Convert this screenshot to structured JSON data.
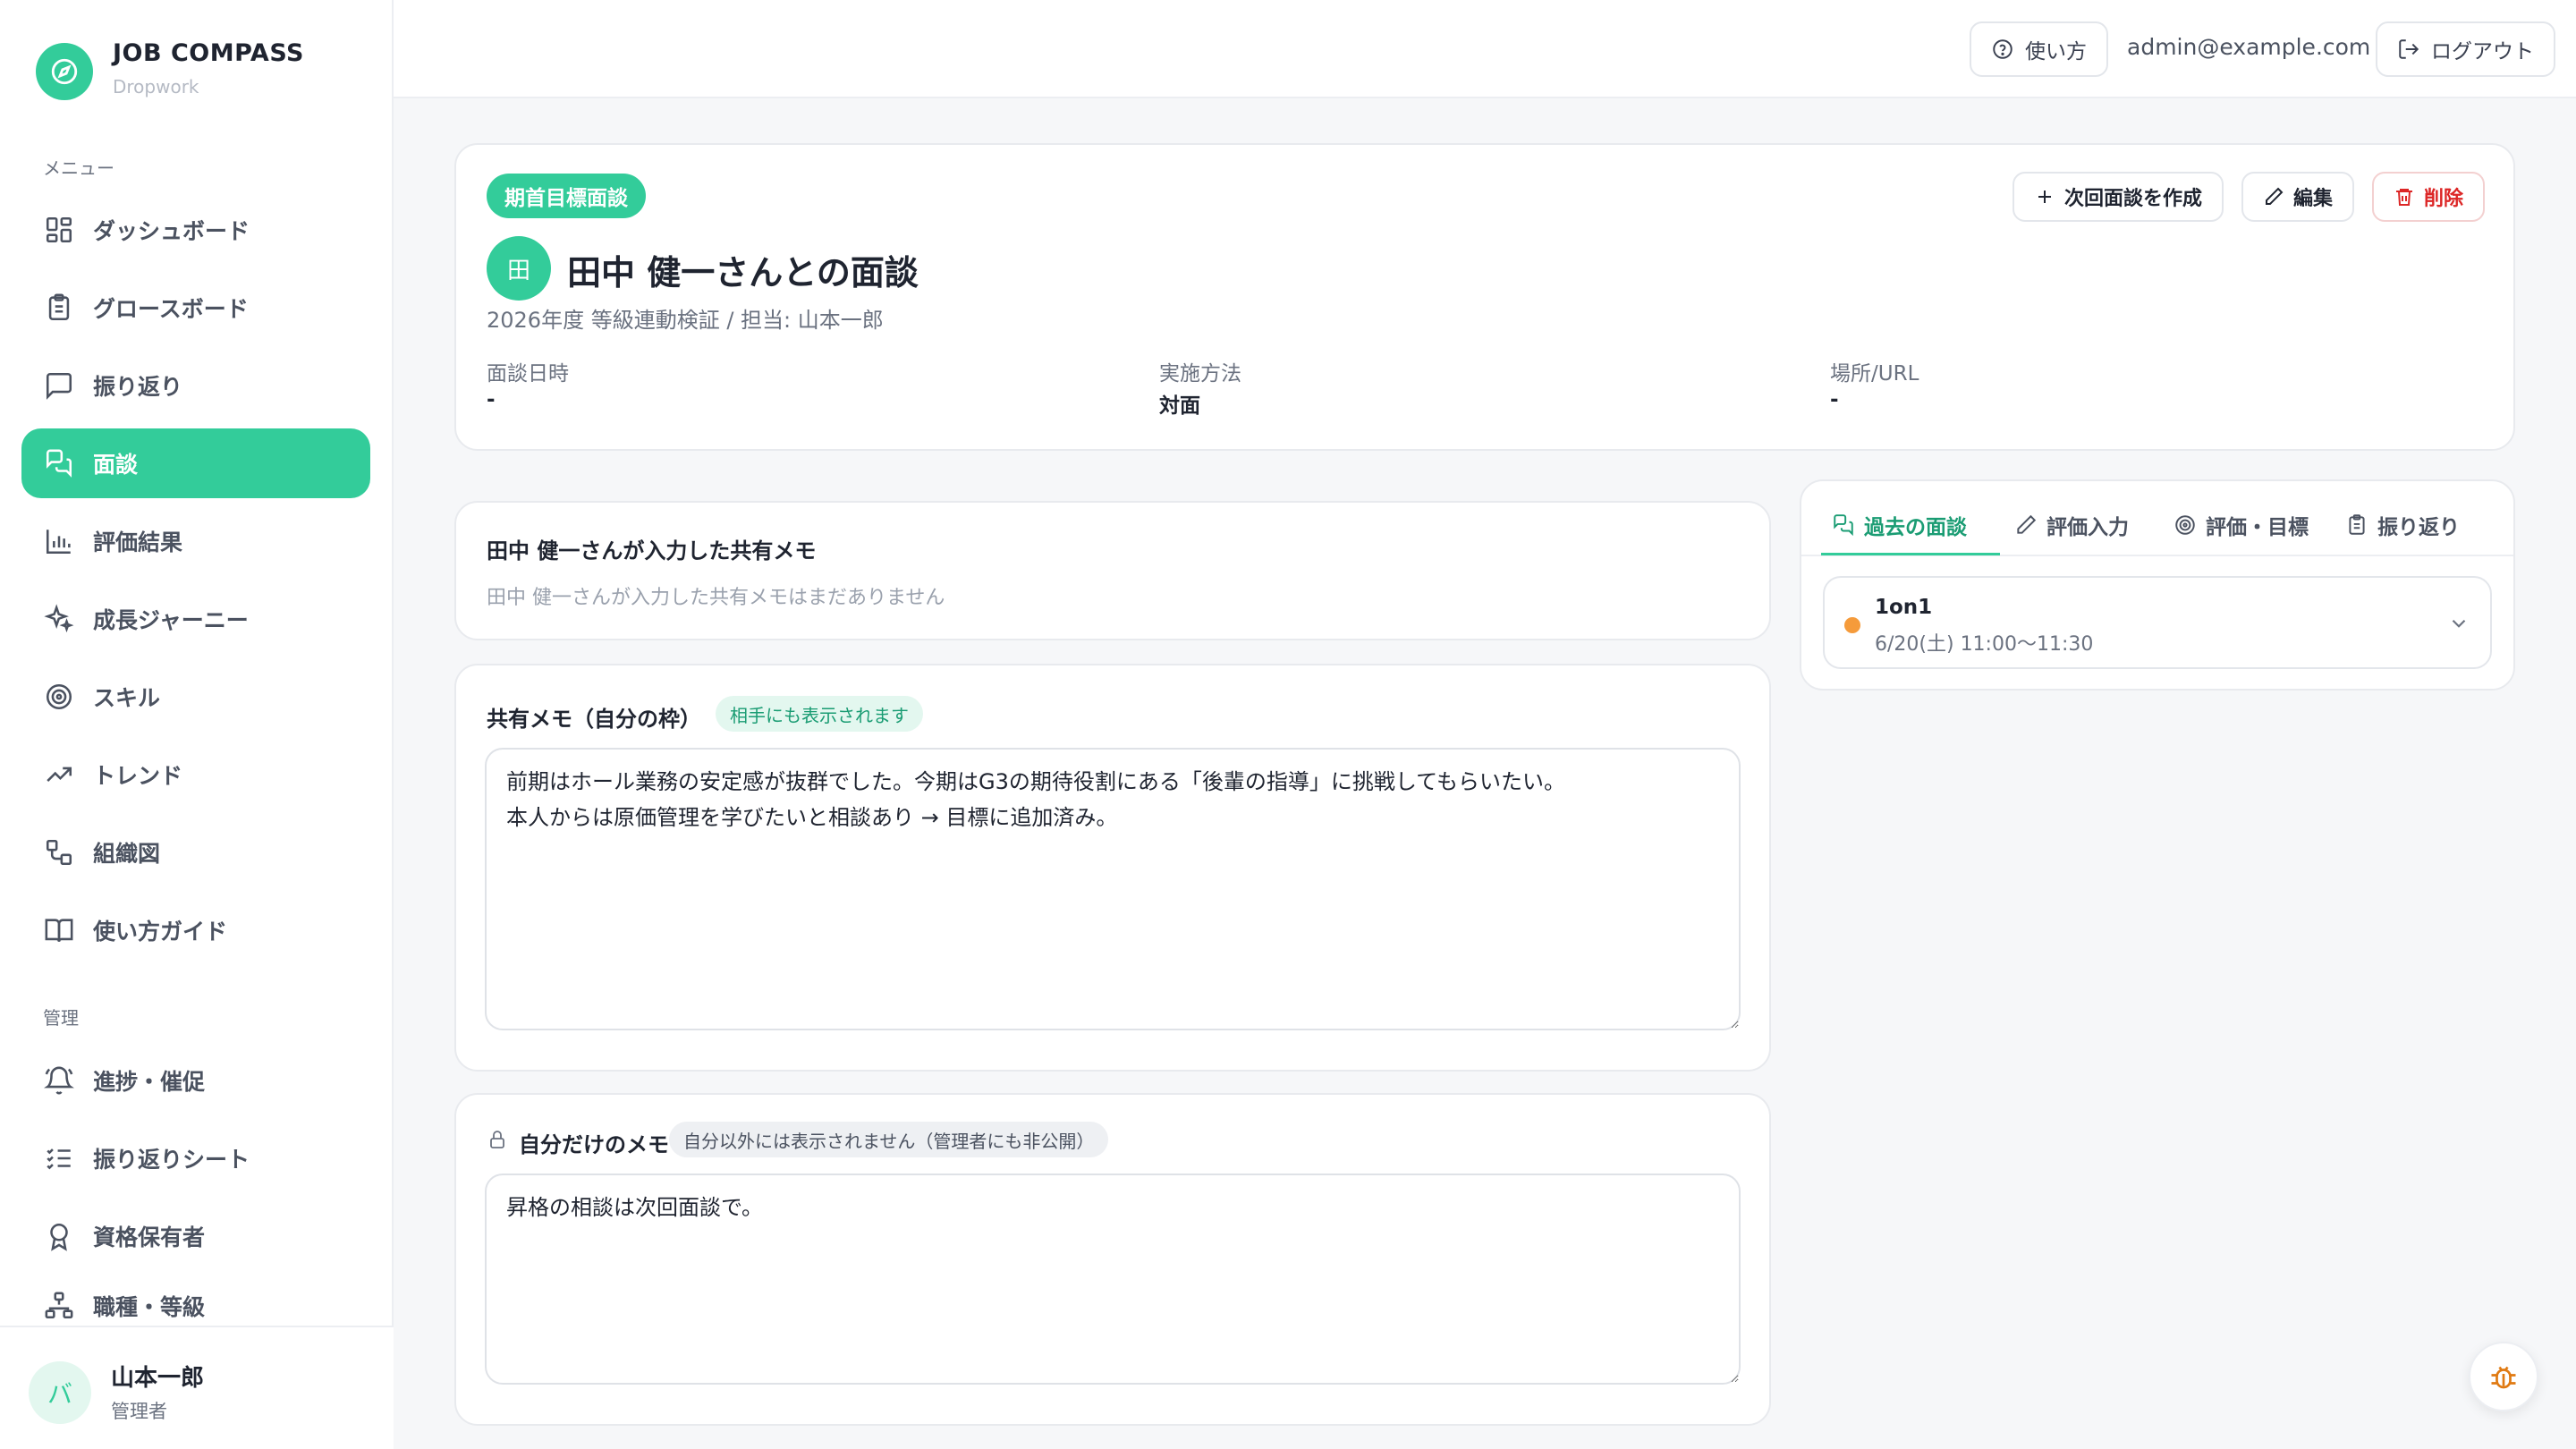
{
  "app": {
    "title": "JOB COMPASS",
    "subtitle": "Dropwork"
  },
  "sidebar": {
    "menu_label": "メニュー",
    "admin_label": "管理",
    "items": [
      {
        "label": "ダッシュボード",
        "icon": "grid-icon"
      },
      {
        "label": "グロースボード",
        "icon": "clipboard-icon"
      },
      {
        "label": "振り返り",
        "icon": "message-square-icon"
      },
      {
        "label": "面談",
        "icon": "chat-bubbles-icon",
        "active": true
      },
      {
        "label": "評価結果",
        "icon": "bar-chart-icon"
      },
      {
        "label": "成長ジャーニー",
        "icon": "sparkles-icon"
      },
      {
        "label": "スキル",
        "icon": "target-icon"
      },
      {
        "label": "トレンド",
        "icon": "trend-icon"
      },
      {
        "label": "組織図",
        "icon": "org-icon"
      },
      {
        "label": "使い方ガイド",
        "icon": "book-icon"
      }
    ],
    "admin_items": [
      {
        "label": "進捗・催促",
        "icon": "bell-icon"
      },
      {
        "label": "振り返りシート",
        "icon": "checklist-icon"
      },
      {
        "label": "資格保有者",
        "icon": "award-icon"
      },
      {
        "label": "職種・等級",
        "icon": "hierarchy-icon"
      }
    ],
    "user": {
      "initial": "バ",
      "name": "山本一郎",
      "role": "管理者"
    }
  },
  "header": {
    "help_label": "使い方",
    "email": "admin@example.com",
    "logout_label": "ログアウト"
  },
  "detail": {
    "type_badge": "期首目標面談",
    "avatar_initial": "田",
    "title": "田中 健一さんとの面談",
    "subtitle": "2026年度 等級連動検証 / 担当: 山本一郎",
    "actions": {
      "next": "次回面談を作成",
      "edit": "編集",
      "delete": "削除"
    },
    "meta": [
      {
        "label": "面談日時",
        "value": "-"
      },
      {
        "label": "実施方法",
        "value": "対面"
      },
      {
        "label": "場所/URL",
        "value": "-"
      }
    ]
  },
  "partner_memo": {
    "title": "田中 健一さんが入力した共有メモ",
    "empty": "田中 健一さんが入力した共有メモはまだありません"
  },
  "shared_memo": {
    "title": "共有メモ（自分の枠）",
    "badge": "相手にも表示されます",
    "value": "前期はホール業務の安定感が抜群でした。今期はG3の期待役割にある「後輩の指導」に挑戦してもらいたい。\n本人からは原価管理を学びたいと相談あり → 目標に追加済み。"
  },
  "private_memo": {
    "title": "自分だけのメモ",
    "badge": "自分以外には表示されません（管理者にも非公開）",
    "value": "昇格の相談は次回面談で。"
  },
  "side_panel": {
    "tabs": [
      {
        "label": "過去の面談",
        "icon": "chat-bubbles-icon",
        "active": true
      },
      {
        "label": "評価入力",
        "icon": "pencil-icon"
      },
      {
        "label": "評価・目標",
        "icon": "target-icon"
      },
      {
        "label": "振り返り",
        "icon": "clipboard-icon"
      }
    ],
    "history": [
      {
        "title": "1on1",
        "datetime": "6/20(土) 11:00〜11:30",
        "status_color": "#f59b3b"
      }
    ]
  },
  "colors": {
    "accent": "#33cc9a",
    "danger": "#dc2626",
    "status_dot": "#f59b3b"
  }
}
